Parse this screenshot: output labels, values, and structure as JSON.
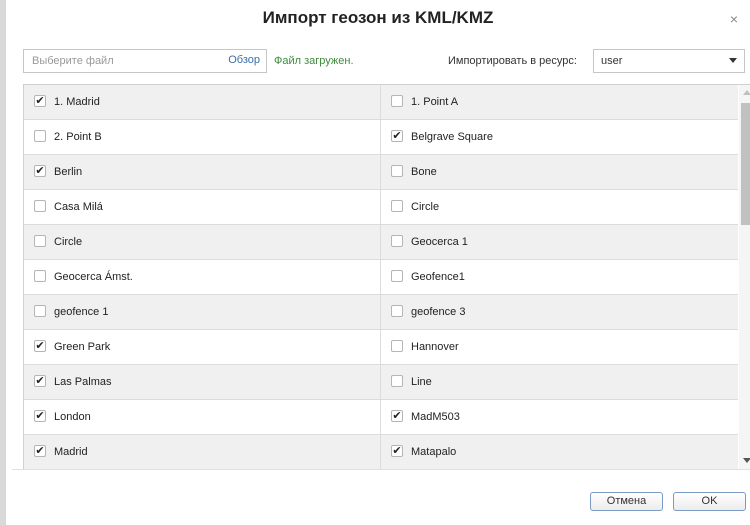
{
  "dialog": {
    "title": "Импорт геозон из KML/KMZ",
    "close_symbol": "×"
  },
  "toolbar": {
    "file_placeholder": "Выберите файл",
    "browse_label": "Обзор",
    "file_status": "Файл загружен.",
    "resource_label": "Импортировать в ресурс:",
    "resource_value": "user"
  },
  "rows": [
    {
      "left": {
        "label": "1. Madrid",
        "checked": true
      },
      "right": {
        "label": "1. Point A",
        "checked": false
      }
    },
    {
      "left": {
        "label": "2. Point B",
        "checked": false
      },
      "right": {
        "label": "Belgrave Square",
        "checked": true
      }
    },
    {
      "left": {
        "label": "Berlin",
        "checked": true
      },
      "right": {
        "label": "Bone",
        "checked": false
      }
    },
    {
      "left": {
        "label": "Casa Milá",
        "checked": false
      },
      "right": {
        "label": "Circle",
        "checked": false
      }
    },
    {
      "left": {
        "label": "Circle",
        "checked": false
      },
      "right": {
        "label": "Geocerca 1",
        "checked": false
      }
    },
    {
      "left": {
        "label": "Geocerca Ámst.",
        "checked": false
      },
      "right": {
        "label": "Geofence1",
        "checked": false
      }
    },
    {
      "left": {
        "label": "geofence 1",
        "checked": false
      },
      "right": {
        "label": "geofence 3",
        "checked": false
      }
    },
    {
      "left": {
        "label": "Green Park",
        "checked": true
      },
      "right": {
        "label": "Hannover",
        "checked": false
      }
    },
    {
      "left": {
        "label": "Las Palmas",
        "checked": true
      },
      "right": {
        "label": "Line",
        "checked": false
      }
    },
    {
      "left": {
        "label": "London",
        "checked": true
      },
      "right": {
        "label": "MadM503",
        "checked": true
      }
    },
    {
      "left": {
        "label": "Madrid",
        "checked": true
      },
      "right": {
        "label": "Matapalo",
        "checked": true
      }
    }
  ],
  "footer": {
    "cancel_label": "Отмена",
    "ok_label": "OK"
  },
  "icons": {
    "checkmark": "✔"
  }
}
